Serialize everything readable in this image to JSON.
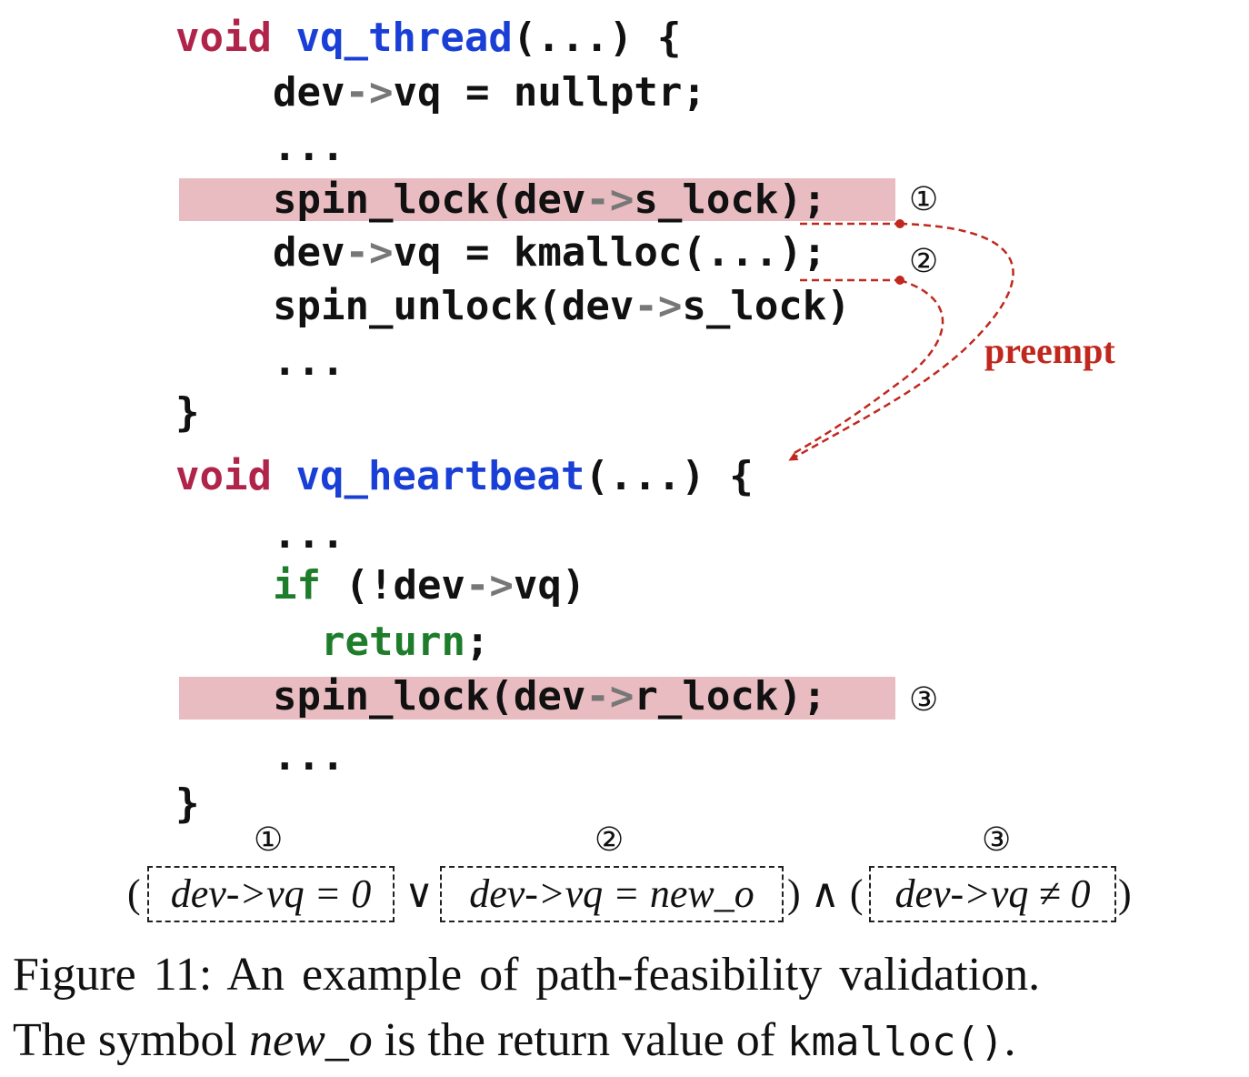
{
  "code": {
    "thread": {
      "kw": "void",
      "name": "vq_thread",
      "sig_rest": "(...) {",
      "l1_a": "dev",
      "l1_arrow": "->",
      "l1_b": "vq = nullptr;",
      "l2": "...",
      "l3_a": "spin_lock(dev",
      "l3_arrow": "->",
      "l3_b": "s_lock);",
      "l4_a": "dev",
      "l4_arrow": "->",
      "l4_b": "vq = kmalloc(...);",
      "l5_a": "spin_unlock(dev",
      "l5_arrow": "->",
      "l5_b": "s_lock)",
      "l6": "...",
      "close": "}"
    },
    "heartbeat": {
      "kw": "void",
      "name": "vq_heartbeat",
      "sig_rest": "(...) {",
      "l1": "...",
      "l2_kw": "if",
      "l2_a": " (!dev",
      "l2_arrow": "->",
      "l2_b": "vq)",
      "l3_kw": "return",
      "l3_b": ";",
      "l4_a": "spin_lock(dev",
      "l4_arrow": "->",
      "l4_b": "r_lock);",
      "l5": "...",
      "close": "}"
    }
  },
  "markers": {
    "m1": "①",
    "m2": "②",
    "m3": "③"
  },
  "annotation": {
    "preempt": "preempt",
    "color": "#c0281e"
  },
  "formula": {
    "open1": "(",
    "term1": "dev->vq = 0",
    "or_op": " ∨",
    "term2": "dev->vq = new_o",
    "close_and": ") ∧ (",
    "term3": "dev->vq ≠ 0",
    "close2": ")"
  },
  "caption": {
    "line1": "Figure 11:  An example of path-feasibility validation.",
    "line2_a": "The symbol ",
    "line2_sym": "new_o",
    "line2_b": " is the return value of ",
    "line2_code": "kmalloc()",
    "line2_c": "."
  },
  "colors": {
    "keyword": "#b0244a",
    "function": "#1a3fd6",
    "control": "#1e7d2a",
    "highlight": "#e8bcc0",
    "arrow_text": "#777777"
  }
}
